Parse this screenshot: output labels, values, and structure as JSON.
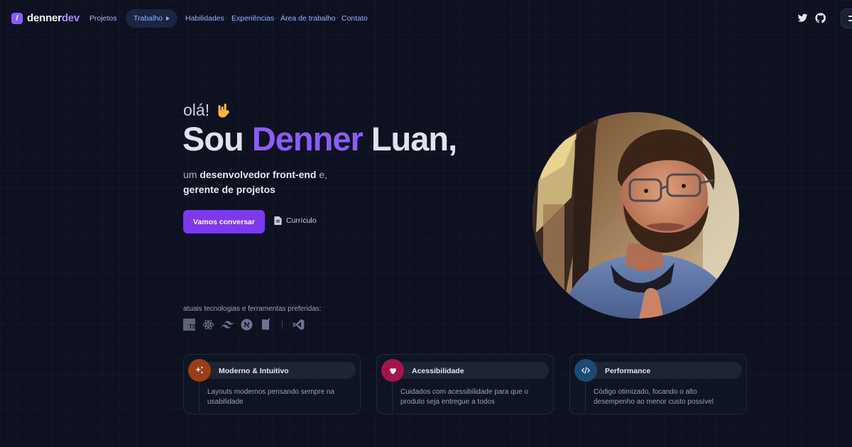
{
  "nav": {
    "logo_mark": "/",
    "logo_name": "denner",
    "logo_accent": "dev",
    "projects": "Projetos",
    "work": "Trabalho",
    "skills": "Habilidades",
    "experiences": "Experiências",
    "workspace": "Área de trabalho",
    "contact": "Contato",
    "separator": "·",
    "social_icons": [
      "twitter-icon",
      "github-icon"
    ],
    "menu_icon": "hamburger-icon"
  },
  "hero": {
    "greeting": "olá!",
    "greeting_emoji": "rock-hand-icon",
    "headline_prefix": "Sou ",
    "headline_accent": "Denner",
    "headline_suffix": " Luan,",
    "sub_1": "um ",
    "sub_bold_1": "desenvolvedor front-end",
    "sub_2": " e,",
    "sub_bold_2": "gerente de projetos",
    "cta": "Vamos conversar",
    "cv": "Currículo"
  },
  "tech": {
    "label": "atuais tecnologias e ferramentas preferidas:",
    "icons": [
      "typescript-icon",
      "react-icon",
      "tailwind-icon",
      "nextjs-icon",
      "storybook-icon",
      "vscode-icon"
    ]
  },
  "features": [
    {
      "title": "Moderno & Intuitivo",
      "desc": "Layouts modernos pensando sempre na usabilidade",
      "icon": "sparkles-icon",
      "color": "#b45309"
    },
    {
      "title": "Acessibilidade",
      "desc": "Cuidados com acessibilidade para que o produto seja entregue a todos",
      "icon": "heart-icon",
      "color": "#be185d"
    },
    {
      "title": "Performance",
      "desc": "Código otimizado, focando o alto desempenho ao menor custo possível",
      "icon": "code-icon",
      "color": "#1e5a8a"
    }
  ],
  "colors": {
    "accent": "#8b5cf6",
    "button": "#7c3aed",
    "background": "#0e1220"
  }
}
